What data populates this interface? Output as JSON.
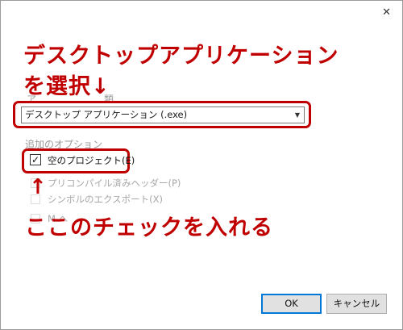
{
  "window": {
    "close_glyph": "✕"
  },
  "annotations": {
    "top_line1": "デスクトップアプリケーション",
    "top_line2": "を選択↓",
    "bottom": "ここのチェックを入れる",
    "bottom_arrow": "↑",
    "color": "#c00000"
  },
  "application_type": {
    "label_partial": "ア　　　　　　　類",
    "selected_value": "デスクトップ アプリケーション (.exe)"
  },
  "additional_options": {
    "label_partial": "追加のオプション"
  },
  "checkboxes": [
    {
      "label": "空のプロジェクト(E)",
      "checked": true,
      "enabled": true
    },
    {
      "label": "プリコンパイル済みヘッダー(P)",
      "checked": false,
      "enabled": false
    },
    {
      "label": "シンボルのエクスポート(X)",
      "checked": false,
      "enabled": false
    },
    {
      "label": "M  ヘ",
      "checked": false,
      "enabled": false
    }
  ],
  "buttons": {
    "ok": "OK",
    "cancel": "キャンセル"
  }
}
